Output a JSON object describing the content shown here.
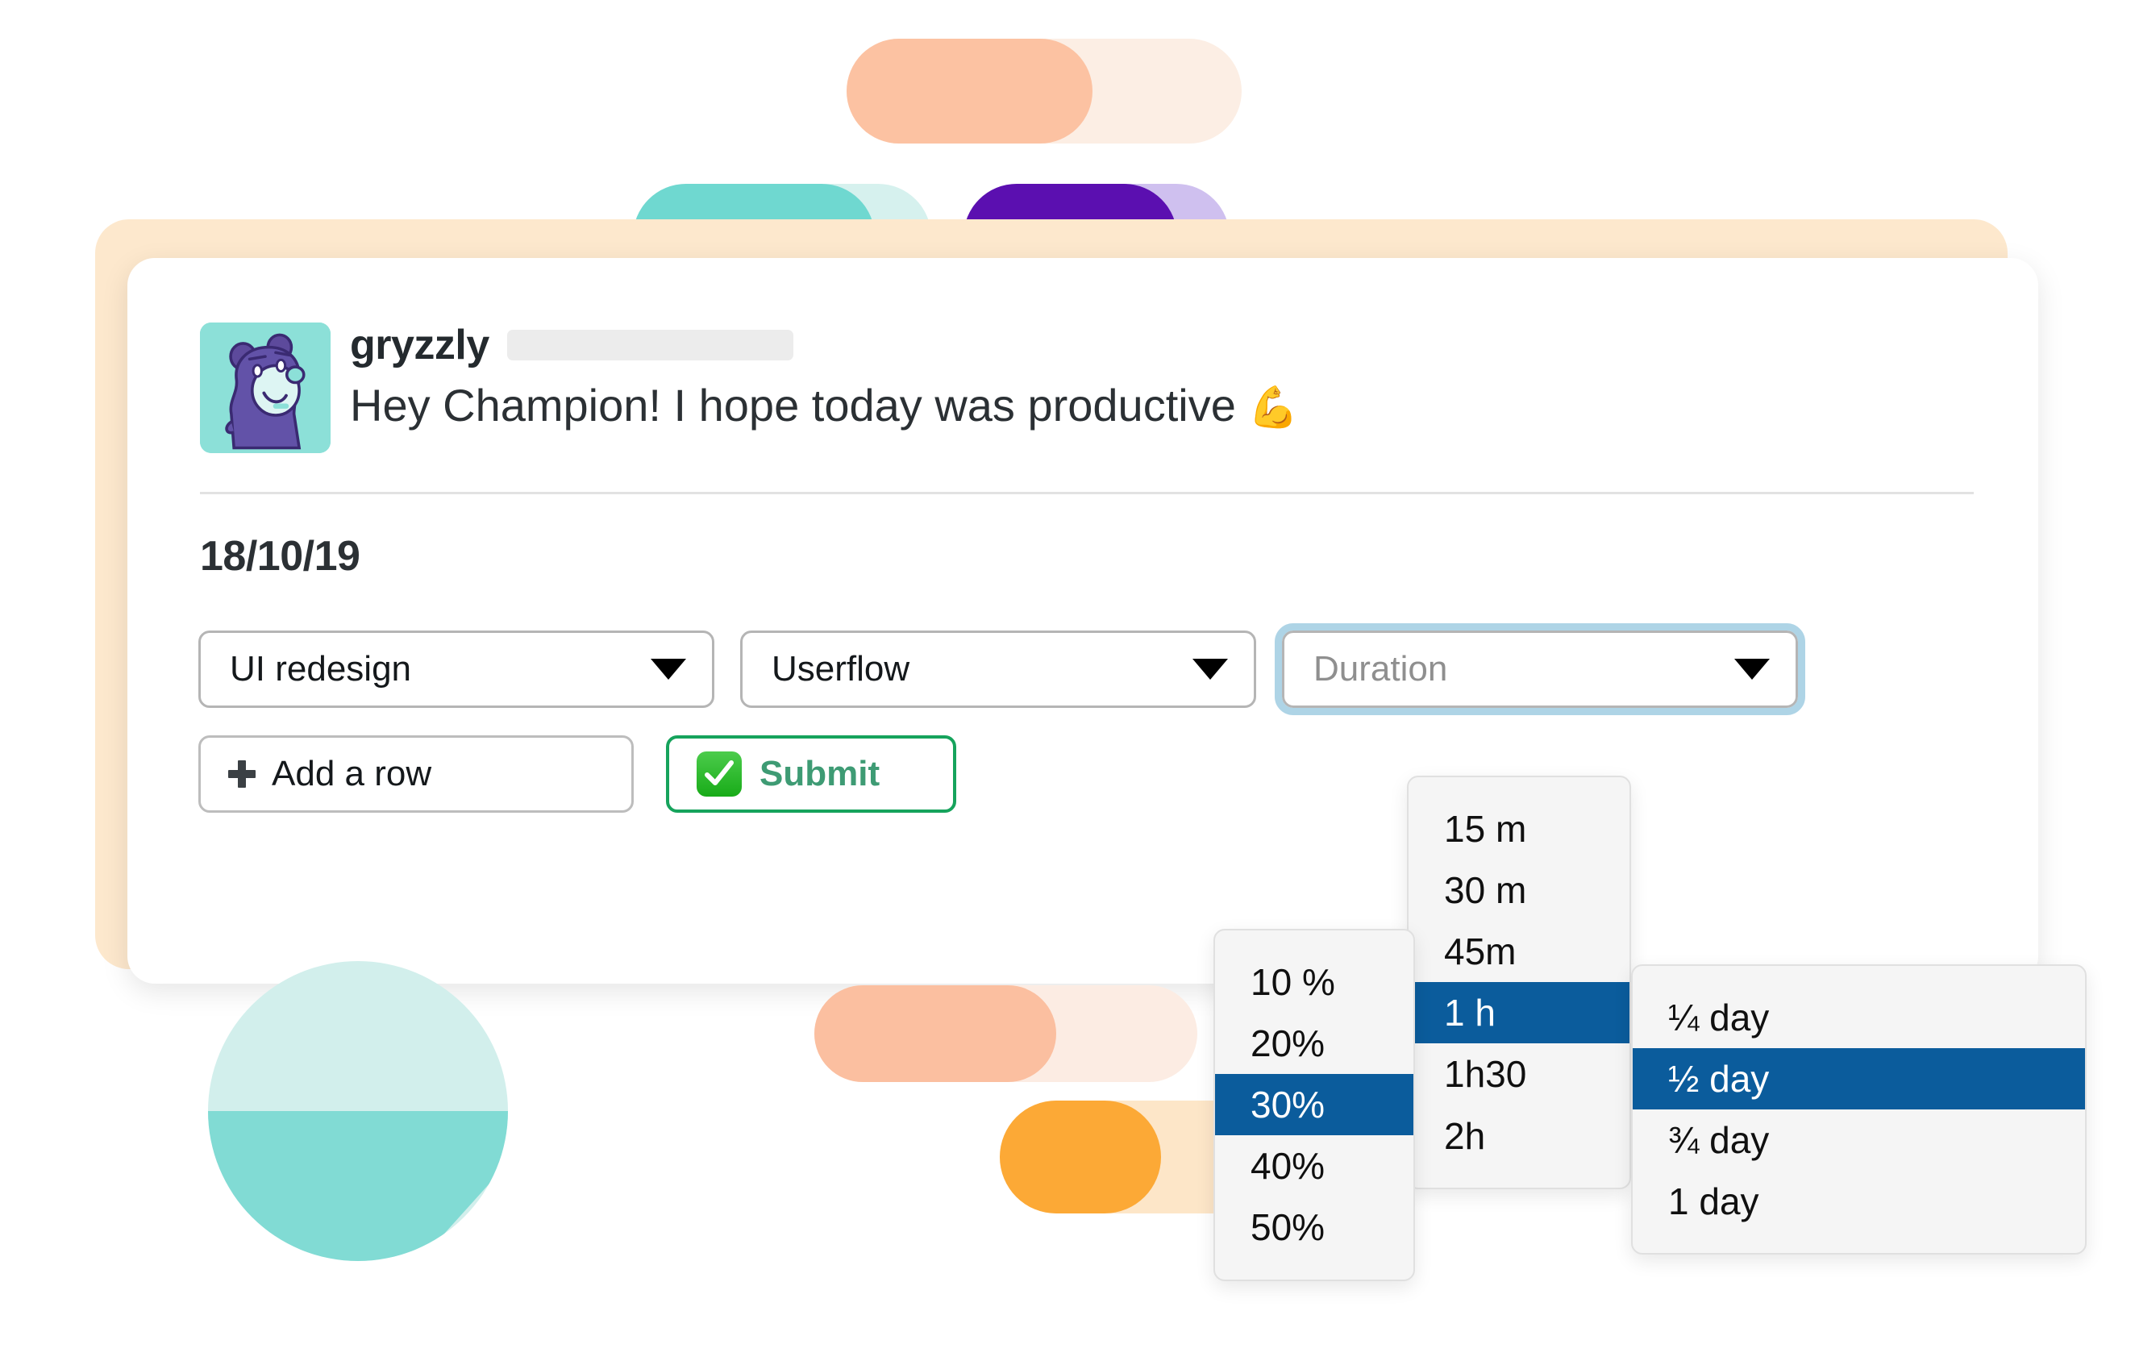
{
  "decor": {
    "colors": {
      "peach_pale": "#fceee4",
      "peach_solid": "#fcc2a2",
      "teal_pale": "#d6f1ee",
      "teal_solid": "#6fd8d0",
      "purple_pale": "#cfc0ef",
      "purple_solid": "#5b0fb0",
      "salmon_pale": "#fcece3",
      "salmon_solid": "#fbbfa0",
      "orange_pale": "#fde6c8",
      "orange_solid": "#fca936",
      "circle_pale": "#d2efec",
      "circle_wedge": "#81dbd4",
      "card_backdrop": "#fde8cd"
    }
  },
  "message": {
    "avatar_icon": "bear-avatar-icon",
    "avatar_bg": "#8ce0d8",
    "username": "gryzzly",
    "greeting": "Hey Champion! I hope today was productive",
    "greeting_emoji": "💪",
    "date": "18/10/19"
  },
  "selects": [
    {
      "name": "project",
      "value": "UI redesign",
      "is_placeholder": false,
      "focused": false,
      "caret_icon": "chevron-down-icon"
    },
    {
      "name": "task",
      "value": "Userflow",
      "is_placeholder": false,
      "focused": false,
      "caret_icon": "chevron-down-icon"
    },
    {
      "name": "duration",
      "value": "Duration",
      "is_placeholder": true,
      "focused": true,
      "caret_icon": "chevron-down-icon"
    }
  ],
  "buttons": {
    "add_row_label": "Add a row",
    "add_row_icon": "plus-icon",
    "submit_label": "Submit",
    "submit_icon": "white-check-mark-icon",
    "submit_border_color": "#16a35c",
    "submit_text_color": "#3e9b74"
  },
  "menus": {
    "highlight_color": "#0b5c9c",
    "percent": {
      "name": "percent-menu",
      "items": [
        "10 %",
        "20%",
        "30%",
        "40%",
        "50%"
      ],
      "selected_index": 2
    },
    "time": {
      "name": "time-menu",
      "items": [
        "15 m",
        "30 m",
        "45m",
        "1 h",
        "1h30",
        "2h"
      ],
      "selected_index": 3
    },
    "day": {
      "name": "day-menu",
      "items": [
        "¼ day",
        "½ day",
        "¾ day",
        "1 day"
      ],
      "selected_index": 1
    }
  }
}
